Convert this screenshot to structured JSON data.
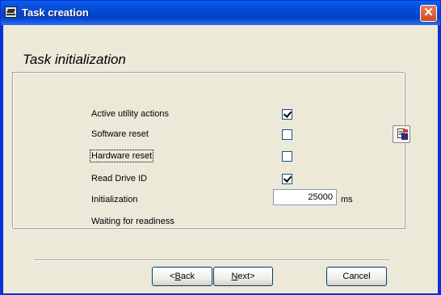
{
  "window": {
    "title": "Task creation",
    "close_symbol": "✕"
  },
  "heading": "Task initialization",
  "options": [
    {
      "label": "Active utility actions",
      "checked": true
    },
    {
      "label": "Software reset",
      "checked": false
    },
    {
      "label": "Hardware reset",
      "checked": false
    },
    {
      "label": "Read Drive ID",
      "checked": true
    },
    {
      "label": "Initialization",
      "checked": false
    }
  ],
  "waiting": {
    "label": "Waiting for readiness",
    "value": "25000",
    "unit": "ms"
  },
  "buttons": {
    "back_mnemonic": "B",
    "back_rest": "ack",
    "back_prefix": "<",
    "next_mnemonic": "N",
    "next_rest": "ext>",
    "cancel": "Cancel"
  },
  "icons": {
    "app": "app-icon",
    "tool": "save-settings-icon"
  }
}
